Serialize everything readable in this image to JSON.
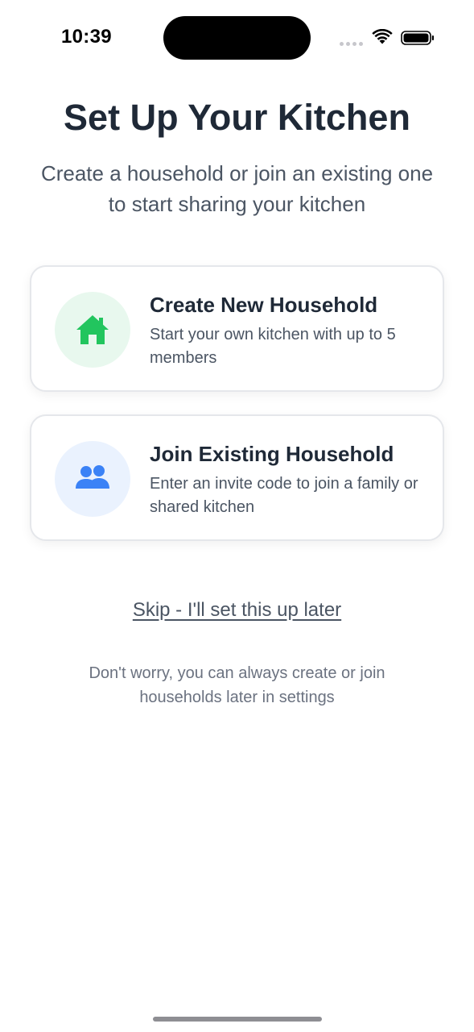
{
  "status_bar": {
    "time": "10:39"
  },
  "header": {
    "title": "Set Up Your Kitchen",
    "subtitle": "Create a household or join an existing one to start sharing your kitchen"
  },
  "options": [
    {
      "title": "Create New Household",
      "description": "Start your own kitchen with up to 5 members",
      "icon": "house-icon",
      "accent": "#22c55e"
    },
    {
      "title": "Join Existing Household",
      "description": "Enter an invite code to join a family or shared kitchen",
      "icon": "users-icon",
      "accent": "#3b82f6"
    }
  ],
  "skip": {
    "label": "Skip - I'll set this up later"
  },
  "footnote": "Don't worry, you can always create or join households later in settings"
}
